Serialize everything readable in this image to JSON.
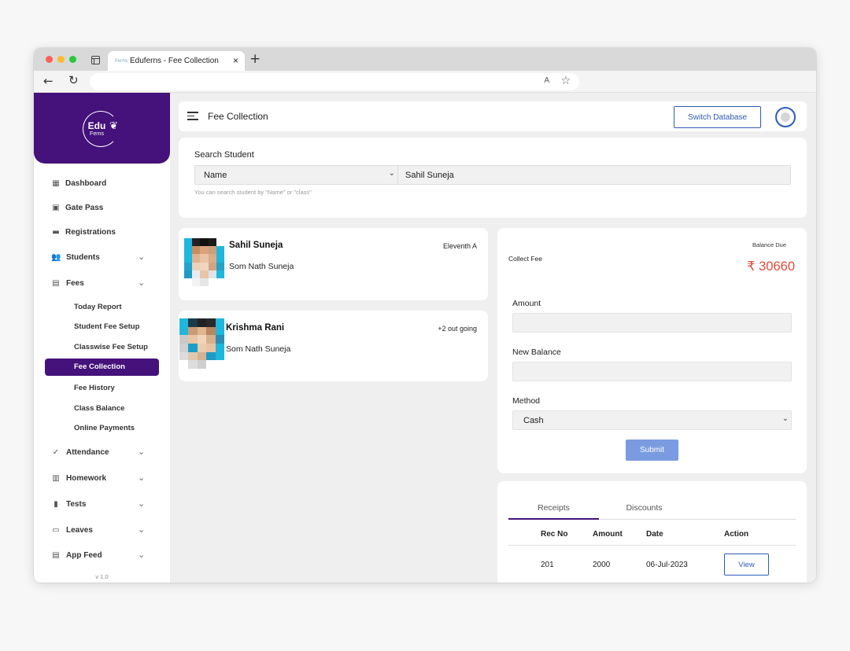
{
  "browser": {
    "tab_title": "Eduferns - Fee Collection",
    "favicon_text": "Ferns",
    "new_tab_label": "+",
    "close_tab_label": "×",
    "read_aloud_label": "A"
  },
  "brand": {
    "logo_text_edu": "Edu",
    "logo_text_ferns": "Ferns",
    "accent_color": "#44127a"
  },
  "sidebar": {
    "menu": [
      {
        "label": "Dashboard",
        "icon": "dashboard-icon"
      },
      {
        "label": "Gate Pass",
        "icon": "gate-pass-icon"
      },
      {
        "label": "Registrations",
        "icon": "registrations-icon"
      },
      {
        "label": "Students",
        "icon": "students-icon"
      },
      {
        "label": "Fees",
        "icon": "fees-icon"
      }
    ],
    "fees_submenu": [
      {
        "label": "Today Report"
      },
      {
        "label": "Student Fee Setup"
      },
      {
        "label": "Classwise Fee Setup"
      },
      {
        "label": "Fee Collection",
        "active": true
      },
      {
        "label": "Fee History"
      },
      {
        "label": "Class Balance"
      },
      {
        "label": "Online Payments"
      }
    ],
    "menu_after": [
      {
        "label": "Attendance",
        "icon": "attendance-icon"
      },
      {
        "label": "Homework",
        "icon": "homework-icon"
      },
      {
        "label": "Tests",
        "icon": "tests-icon"
      },
      {
        "label": "Leaves",
        "icon": "leaves-icon"
      },
      {
        "label": "App Feed",
        "icon": "app-feed-icon"
      }
    ],
    "version": "v 1.0"
  },
  "header": {
    "title": "Fee Collection",
    "switch_label": "Switch Database"
  },
  "search": {
    "label": "Search Student",
    "by_value": "Name",
    "query": "Sahil Suneja",
    "hint": "You can search student by \"Name\" or \"class\""
  },
  "students": [
    {
      "name": "Sahil Suneja",
      "parent": "Som Nath Suneja",
      "tag": "Eleventh A"
    },
    {
      "name": "Krishma Rani",
      "parent": "Som Nath Suneja",
      "tag": "+2 out going"
    }
  ],
  "fee": {
    "collect_label": "Collect Fee",
    "balance_label": "Balance Due",
    "balance_amount": "₹ 30660",
    "amount_label": "Amount",
    "amount_value": "",
    "new_balance_label": "New Balance",
    "new_balance_value": "",
    "method_label": "Method",
    "method_value": "Cash",
    "submit_label": "Submit",
    "balance_color": "#e04a3b"
  },
  "receipts": {
    "tabs": [
      "Receipts",
      "Discounts"
    ],
    "active_tab": "Receipts",
    "headers": [
      "Rec No",
      "Amount",
      "Date",
      "Action"
    ],
    "rows": [
      {
        "rec_no": "201",
        "amount": "2000",
        "date": "06-Jul-2023",
        "action": "View"
      }
    ]
  }
}
